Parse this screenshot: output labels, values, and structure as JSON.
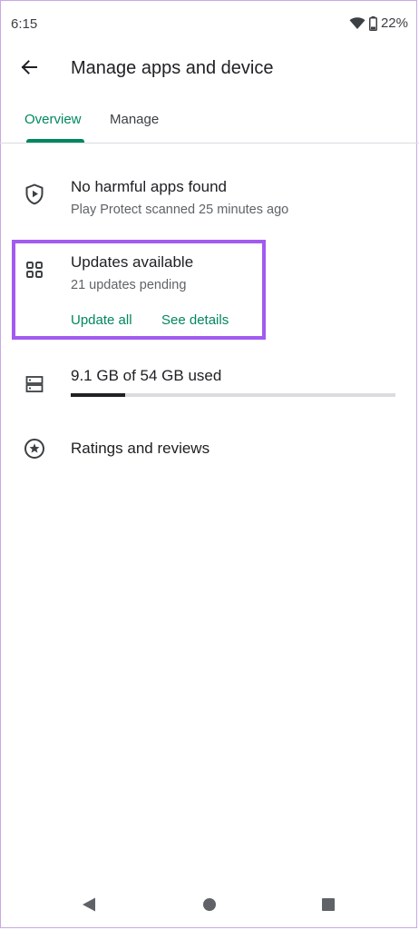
{
  "status_bar": {
    "time": "6:15",
    "battery": "22%",
    "icons": [
      "wifi-icon",
      "battery-icon"
    ]
  },
  "app_bar": {
    "title": "Manage apps and device",
    "back_icon": "arrow-back-icon"
  },
  "tabs": [
    {
      "label": "Overview",
      "selected": true
    },
    {
      "label": "Manage",
      "selected": false
    }
  ],
  "play_protect": {
    "icon": "shield-play-icon",
    "title": "No harmful apps found",
    "subtitle": "Play Protect scanned 25 minutes ago"
  },
  "updates": {
    "icon": "apps-grid-icon",
    "title": "Updates available",
    "subtitle": "21 updates pending",
    "update_all_label": "Update all",
    "see_details_label": "See details",
    "highlighted": true
  },
  "storage": {
    "icon": "storage-icon",
    "text": "9.1 GB of 54 GB used",
    "used_gb": 9.1,
    "total_gb": 54
  },
  "ratings": {
    "icon": "star-circle-icon",
    "label": "Ratings and reviews"
  },
  "nav_bar": {
    "icons": [
      "nav-back-icon",
      "nav-home-icon",
      "nav-recents-icon"
    ]
  },
  "colors": {
    "accent": "#01875f",
    "highlight": "#a25bf0",
    "text_primary": "#202124",
    "text_secondary": "#5f6368",
    "divider": "#dadce0"
  }
}
